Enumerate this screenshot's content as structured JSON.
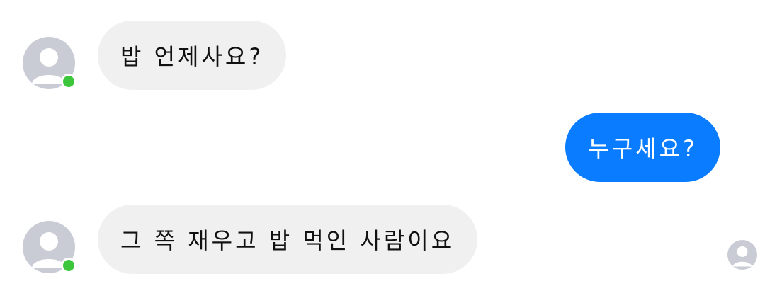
{
  "conversation": {
    "messages": [
      {
        "direction": "incoming",
        "text": "밥 언제사요?",
        "sender_online": true
      },
      {
        "direction": "outgoing",
        "text": "누구세요?"
      },
      {
        "direction": "incoming",
        "text": "그 쪽 재우고 밥 먹인 사람이요",
        "sender_online": true
      }
    ],
    "read_receipt": {
      "icon": "user-avatar-icon"
    }
  },
  "colors": {
    "incoming_bubble": "#f0f0f0",
    "outgoing_bubble": "#0a7cff",
    "online_indicator": "#3bc63b",
    "avatar_placeholder": "#c9ccd4"
  }
}
